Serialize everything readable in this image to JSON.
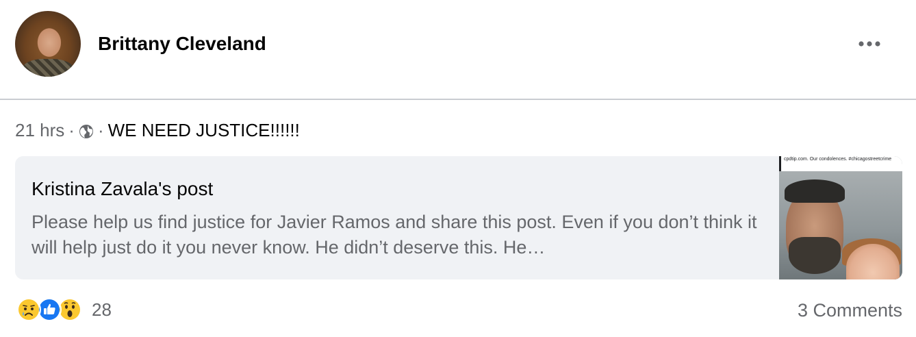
{
  "post": {
    "author": "Brittany Cleveland",
    "time": "21 hrs",
    "separator": "·",
    "privacy_icon": "globe-icon",
    "text": "WE NEED JUSTICE!!!!!!"
  },
  "shared_post": {
    "title": "Kristina Zavala's post",
    "body": "Please help us find justice for Javier Ramos and share this post. Even if you don’t think it will help just do it you never know. He didn’t deserve this. He…",
    "thumbnail_caption": "cpdtip.com. Our condolences. #chicagostreetcrime"
  },
  "reactions": {
    "icons": [
      "sad-reaction-icon",
      "like-reaction-icon",
      "wow-reaction-icon"
    ],
    "count": "28"
  },
  "comments": {
    "label": "3 Comments"
  },
  "colors": {
    "primary_text": "#050505",
    "secondary_text": "#65676b",
    "card_bg": "#f0f2f5",
    "like_blue": "#1877f2",
    "emoji_yellow": "#fbc82f"
  }
}
